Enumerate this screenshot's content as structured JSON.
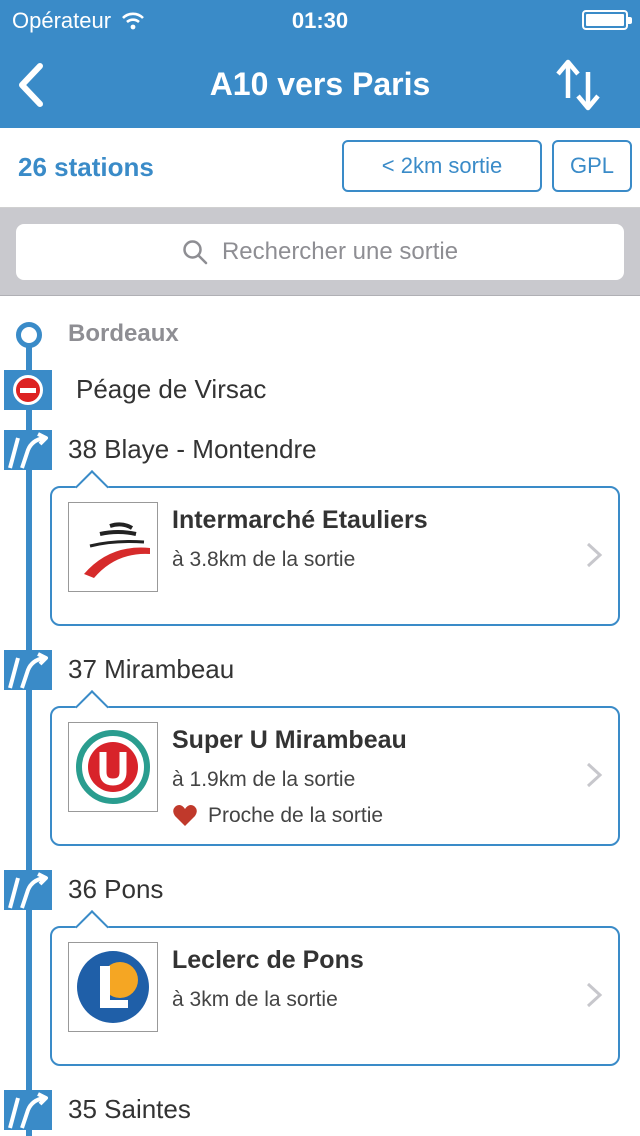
{
  "status": {
    "carrier": "Opérateur",
    "time": "01:30"
  },
  "nav": {
    "title": "A10 vers Paris",
    "back_icon": "chevron-left-icon",
    "swap_icon": "swap-vertical-icon"
  },
  "filter": {
    "count": "26 stations",
    "km_label": "< 2km sortie",
    "gpl_label": "GPL"
  },
  "search": {
    "placeholder": "Rechercher une sortie"
  },
  "route": {
    "origin": "Bordeaux",
    "toll": "Péage de Virsac",
    "exits": [
      {
        "label": "38 Blaye - Montendre",
        "station": {
          "name": "Intermarché Etauliers",
          "distance": "à 3.8km de la sortie",
          "logo": "intermarche-logo"
        }
      },
      {
        "label": "37 Mirambeau",
        "station": {
          "name": "Super U Mirambeau",
          "distance": "à 1.9km de la sortie",
          "favorite": "Proche de la sortie",
          "logo": "super-u-logo"
        }
      },
      {
        "label": "36 Pons",
        "station": {
          "name": "Leclerc de Pons",
          "distance": "à 3km de la sortie",
          "logo": "leclerc-logo"
        }
      },
      {
        "label": "35 Saintes"
      }
    ]
  },
  "colors": {
    "brand": "#3a8bc8",
    "heart": "#c0392b"
  }
}
